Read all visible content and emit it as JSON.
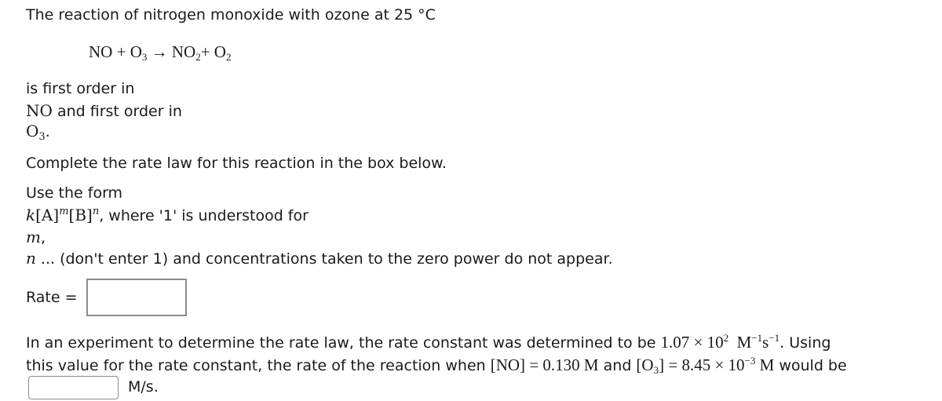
{
  "intro": {
    "text": "The reaction of nitrogen monoxide with ozone at 25 °C"
  },
  "equation": {
    "r1": "NO",
    "plus1": " + ",
    "r2_base": "O",
    "r2_sub": "3",
    "arrow": " → ",
    "p1_base": "NO",
    "p1_sub": "2",
    "plus2": "+ ",
    "p2_base": "O",
    "p2_sub": "2"
  },
  "order": {
    "line1": "is first order in",
    "species1": "NO",
    "line2_rest": " and first order in",
    "species2_base": "O",
    "species2_sub": "3",
    "period": "."
  },
  "instructions": {
    "complete": "Complete the rate law for this reaction in the box below.",
    "use_form": "Use the form",
    "form_k": "k",
    "form_A": "[A]",
    "form_m": "m",
    "form_B": "[B]",
    "form_n": "n",
    "form_rest": ", where '1' is understood for",
    "m_line_var": "m",
    "m_line_comma": ",",
    "n_line_var": "n",
    "n_line_rest": " ... (don't enter 1) and concentrations taken to the zero power do not appear."
  },
  "rate_field": {
    "label": "Rate =",
    "value": "",
    "placeholder": ""
  },
  "experiment": {
    "line1_text": "In an experiment to determine the rate law, the rate constant was determined to be ",
    "k_mantissa": "1.07",
    "times": " × ",
    "k_base": "10",
    "k_exp": "2",
    "k_unit_M": "M",
    "k_unit_M_exp": "−1",
    "k_unit_s": "s",
    "k_unit_s_exp": "−1",
    "line1_end": ". Using",
    "line2_text": "this value for the rate constant, the rate of the reaction when ",
    "no_conc_label": "[NO]",
    "equals": " = ",
    "no_conc_value": "0.130 M",
    "and": " and ",
    "o3_open": "[O",
    "o3_sub": "3",
    "o3_close": "]",
    "o3_mantissa": "8.45",
    "o3_base": "10",
    "o3_exp": "−3",
    "o3_unit": " M",
    "line2_end": " would be"
  },
  "answer_field": {
    "value": "",
    "placeholder": "",
    "unit": "M/s."
  }
}
